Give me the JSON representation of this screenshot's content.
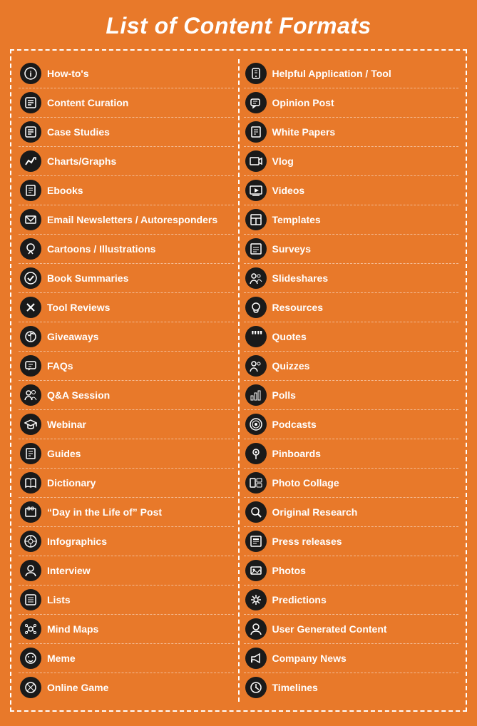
{
  "title": "List of Content Formats",
  "left_column": [
    {
      "label": "How-to's",
      "icon": "ℹ",
      "shape": "circle"
    },
    {
      "label": "Content Curation",
      "icon": "✏",
      "shape": "circle"
    },
    {
      "label": "Case Studies",
      "icon": "📋",
      "shape": "rounded"
    },
    {
      "label": "Charts/Graphs",
      "icon": "📈",
      "shape": "circle"
    },
    {
      "label": "Ebooks",
      "icon": "📖",
      "shape": "circle"
    },
    {
      "label": "Email Newsletters / Autoresponders",
      "icon": "✉",
      "shape": "rounded"
    },
    {
      "label": "Cartoons / Illustrations",
      "icon": "🎨",
      "shape": "circle"
    },
    {
      "label": "Book Summaries",
      "icon": "✔",
      "shape": "circle"
    },
    {
      "label": "Tool Reviews",
      "icon": "✂",
      "shape": "circle"
    },
    {
      "label": "Giveaways",
      "icon": "🎁",
      "shape": "circle"
    },
    {
      "label": "FAQs",
      "icon": "💬",
      "shape": "circle"
    },
    {
      "label": "Q&A Session",
      "icon": "👥",
      "shape": "circle"
    },
    {
      "label": "Webinar",
      "icon": "🎓",
      "shape": "circle"
    },
    {
      "label": "Guides",
      "icon": "📋",
      "shape": "circle"
    },
    {
      "label": "Dictionary",
      "icon": "📚",
      "shape": "circle"
    },
    {
      "label": "“Day in the Life of” Post",
      "icon": "💻",
      "shape": "circle"
    },
    {
      "label": "Infographics",
      "icon": "🔄",
      "shape": "circle"
    },
    {
      "label": "Interview",
      "icon": "👤",
      "shape": "circle"
    },
    {
      "label": "Lists",
      "icon": "📝",
      "shape": "circle"
    },
    {
      "label": "Mind Maps",
      "icon": "🧠",
      "shape": "circle"
    },
    {
      "label": "Meme",
      "icon": "📷",
      "shape": "circle"
    },
    {
      "label": "Online Game",
      "icon": "🎮",
      "shape": "circle"
    }
  ],
  "right_column": [
    {
      "label": "Helpful Application / Tool",
      "icon": "📱",
      "shape": "rounded"
    },
    {
      "label": "Opinion Post",
      "icon": "💬",
      "shape": "rounded"
    },
    {
      "label": "White Papers",
      "icon": "📄",
      "shape": "rounded"
    },
    {
      "label": "Vlog",
      "icon": "📷",
      "shape": "rounded"
    },
    {
      "label": "Videos",
      "icon": "🖥",
      "shape": "circle"
    },
    {
      "label": "Templates",
      "icon": "📋",
      "shape": "circle"
    },
    {
      "label": "Surveys",
      "icon": "📊",
      "shape": "circle"
    },
    {
      "label": "Slideshares",
      "icon": "👥",
      "shape": "circle"
    },
    {
      "label": "Resources",
      "icon": "💡",
      "shape": "circle"
    },
    {
      "label": "Quotes",
      "icon": "❝",
      "shape": "circle"
    },
    {
      "label": "Quizzes",
      "icon": "👤",
      "shape": "circle"
    },
    {
      "label": "Polls",
      "icon": "📊",
      "shape": "circle"
    },
    {
      "label": "Podcasts",
      "icon": "📡",
      "shape": "circle"
    },
    {
      "label": "Pinboards",
      "icon": "📌",
      "shape": "circle"
    },
    {
      "label": "Photo Collage",
      "icon": "🖼",
      "shape": "rounded"
    },
    {
      "label": "Original Research",
      "icon": "🔍",
      "shape": "circle"
    },
    {
      "label": "Press releases",
      "icon": "📰",
      "shape": "circle"
    },
    {
      "label": "Photos",
      "icon": "🖼",
      "shape": "rounded"
    },
    {
      "label": "Predictions",
      "icon": "⚙",
      "shape": "circle"
    },
    {
      "label": "User Generated Content",
      "icon": "👤",
      "shape": "circle"
    },
    {
      "label": "Company News",
      "icon": "📢",
      "shape": "circle"
    },
    {
      "label": "Timelines",
      "icon": "⚙",
      "shape": "circle"
    }
  ],
  "icons": {
    "howtos": "ℹ",
    "curation": "✏",
    "case": "📋",
    "charts": "📈",
    "ebooks": "📖",
    "email": "✉",
    "cartoons": "🎨",
    "book": "☑",
    "tool": "✂",
    "giveaways": "🎁",
    "faqs": "💬",
    "qa": "👥",
    "webinar": "🎓",
    "guides": "📋",
    "dictionary": "📚",
    "dayinlife": "💻",
    "infographics": "🔄",
    "interview": "👤",
    "lists": "📝",
    "mindmaps": "🧠",
    "meme": "📸",
    "game": "🎮"
  }
}
